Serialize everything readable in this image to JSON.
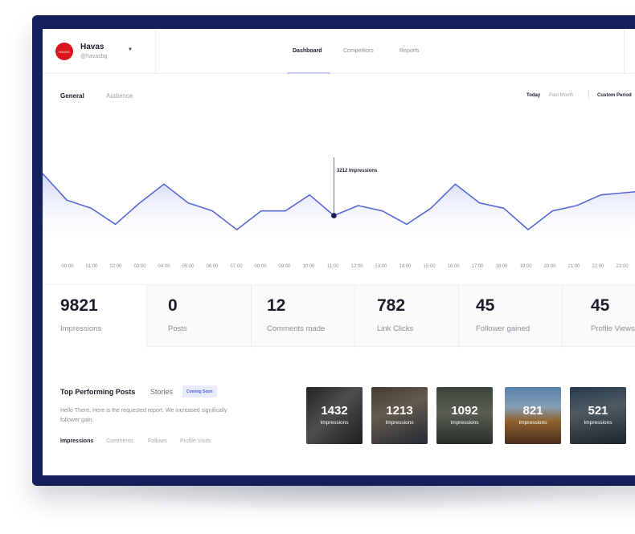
{
  "header": {
    "brand_name": "Havas",
    "brand_handle": "@havasbg",
    "avatar_text": "HAVAS",
    "nav": [
      "Dashboard",
      "Competitors",
      "Reports"
    ],
    "active_nav": "Dashboard"
  },
  "tabs": [
    "General",
    "Audience"
  ],
  "active_tab": "General",
  "ranges": [
    "Today",
    "Past Month",
    "Custom Period"
  ],
  "chart_data": {
    "type": "line",
    "x": [
      "00:00",
      "01:00",
      "02:00",
      "03:00",
      "04:00",
      "05:00",
      "06:00",
      "07:00",
      "08:00",
      "09:00",
      "10:00",
      "11:00",
      "12:00",
      "13:00",
      "14:00",
      "15:00",
      "16:00",
      "17:00",
      "18:00",
      "19:00",
      "20:00",
      "21:00",
      "22:00",
      "23:00"
    ],
    "series": [
      {
        "values": [
          4000,
          3500,
          3350,
          3050,
          3450,
          3800,
          3450,
          3300,
          2950,
          3300,
          3300,
          3600,
          3212,
          3400,
          3300,
          3050,
          3350,
          3800,
          3450,
          3350,
          2950,
          3300,
          3400,
          3600
        ]
      }
    ],
    "tooltip": {
      "label": "3212 Impressions"
    },
    "color": "#5868d6"
  },
  "stats": [
    {
      "value": "9821",
      "label": "Impressions"
    },
    {
      "value": "0",
      "label": "Posts"
    },
    {
      "value": "12",
      "label": "Comments made"
    },
    {
      "value": "782",
      "label": "Link Clicks"
    },
    {
      "value": "45",
      "label": "Follower gained"
    },
    {
      "value": "45",
      "label": "Profile Views"
    }
  ],
  "top_posts": {
    "title": "Top Performing Posts",
    "stories_label": "Stories",
    "badge": "Coming Soon",
    "description": "Hello There, Here is the requested report. We increased significally follower gain.",
    "filters": [
      "Impressions",
      "Comments",
      "Follows",
      "Profile Visits"
    ],
    "active_filter": "Impressions",
    "posts": [
      {
        "value": "1432",
        "label": "Impressions"
      },
      {
        "value": "1213",
        "label": "Impressions"
      },
      {
        "value": "1092",
        "label": "Impressions"
      },
      {
        "value": "821",
        "label": "Impressions"
      },
      {
        "value": "521",
        "label": "Impressions"
      }
    ]
  }
}
